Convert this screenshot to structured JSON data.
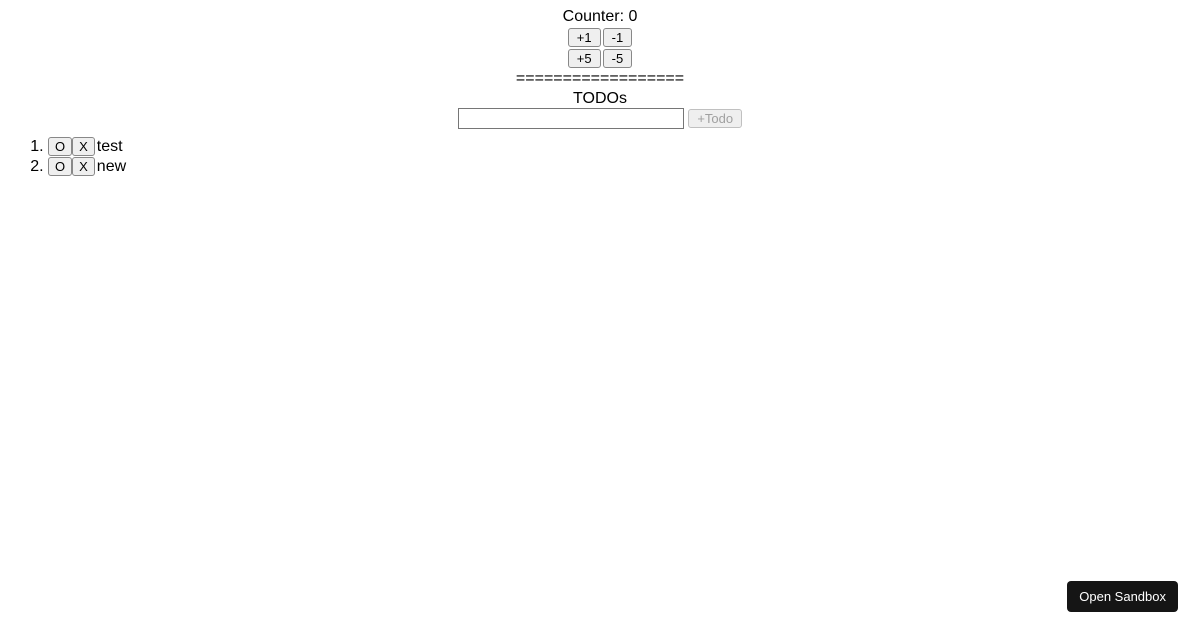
{
  "counter": {
    "label_prefix": "Counter: ",
    "value": "0",
    "plus1": "+1",
    "minus1": "-1",
    "plus5": "+5",
    "minus5": "-5"
  },
  "separator": "==================",
  "todos": {
    "title": "TODOs",
    "input_value": "",
    "add_label": "+Todo",
    "toggle_label": "O",
    "delete_label": "X",
    "items": [
      {
        "text": "test"
      },
      {
        "text": "new"
      }
    ]
  },
  "sandbox": {
    "open_label": "Open Sandbox"
  }
}
